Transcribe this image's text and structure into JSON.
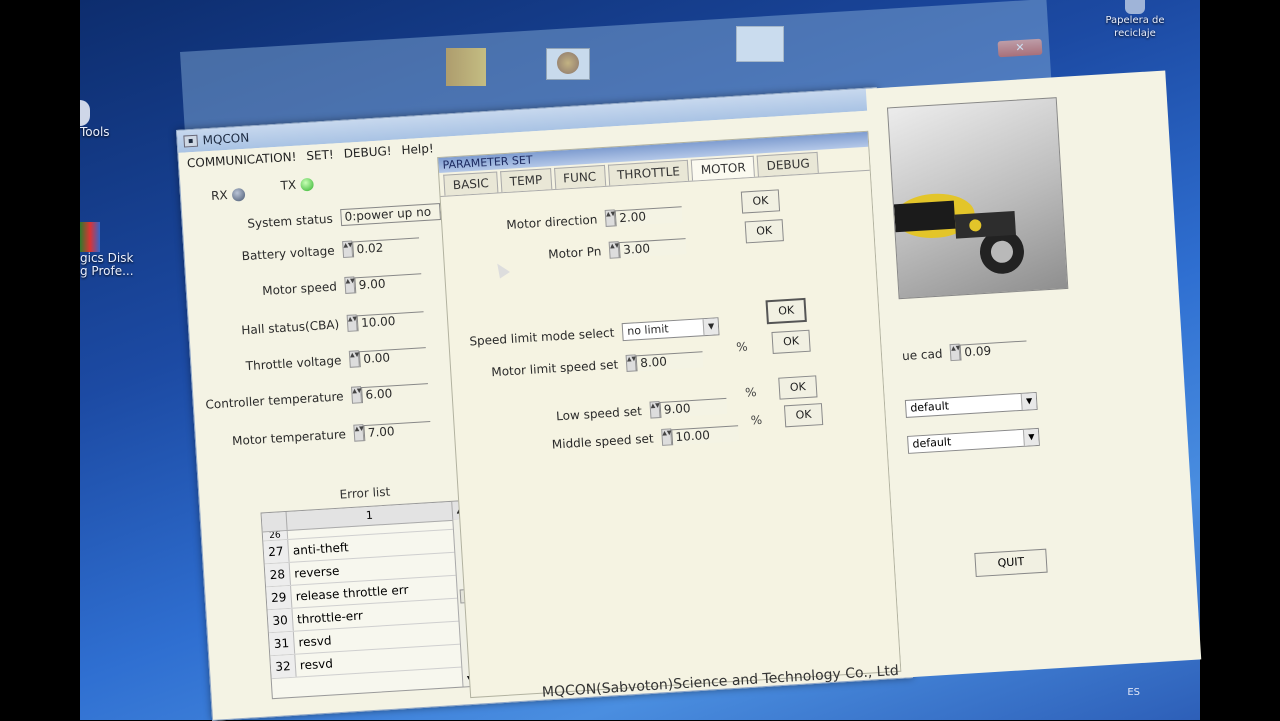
{
  "desktop": {
    "recycle_bin_label": "Papelera de reciclaje",
    "tools_label": "Tools",
    "disk_label_line1": "gics Disk",
    "disk_label_line2": "g Profe...",
    "tray_language": "ES"
  },
  "window": {
    "title": "MQCON",
    "menu": [
      "COMMUNICATION!",
      "SET!",
      "DEBUG!",
      "Help!"
    ],
    "footer": "MQCON(Sabvoton)Science and Technology Co., Ltd",
    "quit_label": "QUIT"
  },
  "status": {
    "rx_label": "RX",
    "tx_label": "TX",
    "system_status_label": "System status",
    "system_status_value": "0:power up no",
    "fields": [
      {
        "label": "Battery voltage",
        "value": "0.02"
      },
      {
        "label": "Motor speed",
        "value": "9.00"
      },
      {
        "label": "Hall status(CBA)",
        "value": "10.00"
      },
      {
        "label": "Throttle voltage",
        "value": "0.00"
      },
      {
        "label": "Controller temperature",
        "value": "6.00"
      },
      {
        "label": "Motor temperature",
        "value": "7.00"
      }
    ]
  },
  "error_list": {
    "title": "Error list",
    "column_header": "1",
    "partial_row_number": "26",
    "rows": [
      {
        "num": "27",
        "text": "anti-theft"
      },
      {
        "num": "28",
        "text": "reverse"
      },
      {
        "num": "29",
        "text": "release throttle err"
      },
      {
        "num": "30",
        "text": "throttle-err"
      },
      {
        "num": "31",
        "text": "resvd"
      },
      {
        "num": "32",
        "text": "resvd"
      }
    ]
  },
  "parameter_set": {
    "title": "PARAMETER SET",
    "tabs": [
      "BASIC",
      "TEMP",
      "FUNC",
      "THROTTLE",
      "MOTOR",
      "DEBUG"
    ],
    "active_tab": "MOTOR",
    "motor_direction_label": "Motor direction",
    "motor_direction_value": "2.00",
    "motor_pn_label": "Motor Pn",
    "motor_pn_value": "3.00",
    "speed_limit_mode_label": "Speed limit mode select",
    "speed_limit_mode_value": "no limit",
    "motor_limit_speed_label": "Motor limit speed set",
    "motor_limit_speed_value": "8.00",
    "low_speed_label": "Low speed set",
    "low_speed_value": "9.00",
    "middle_speed_label": "Middle speed set",
    "middle_speed_value": "10.00",
    "ok_label": "OK",
    "percent": "%"
  },
  "right_panel": {
    "partial_label": "ue cad",
    "partial_value": "0.09",
    "dropdown1_value": "default",
    "dropdown2_value": "default"
  }
}
